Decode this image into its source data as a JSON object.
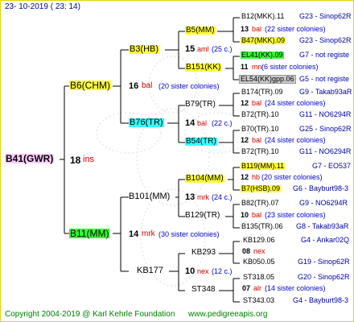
{
  "header": {
    "date": "23- 10-2019 ( 23: 14)"
  },
  "footer": {
    "copyright": "Copyright 2004-2019 @ Karl Kehrle Foundation",
    "url": "www.pedigreeapis.org"
  },
  "root": {
    "name": "B41(GWR)",
    "num": "18",
    "ins": "ins"
  },
  "colors": {
    "line": "#000000",
    "pink": "#ffccff",
    "yellow": "#ffff33",
    "green": "#33ff33",
    "cyan": "#33ffff"
  },
  "gen1": [
    {
      "name": "B6(CHM)",
      "num": "16",
      "word": "bal",
      "sis": "(20 sister colonies)"
    },
    {
      "name": "B11(MM)",
      "num": "14",
      "word": "mrk",
      "sis": "(30 sister colonies)"
    }
  ],
  "gen2": [
    {
      "name": "B3(HB)",
      "num": "15",
      "word": "aml",
      "sis": "(25 c.)"
    },
    {
      "name": "B76(TR)",
      "num": "14",
      "word": "bal",
      "sis": "(22 c.)"
    },
    {
      "name": "B101(MM)",
      "num": "13",
      "word": "mrk",
      "sis": "(24 c.)"
    },
    {
      "name": "KB177",
      "num": "10",
      "word": "nex",
      "sis": "(12 c.)"
    }
  ],
  "gen3": [
    {
      "name": "B5(MM)"
    },
    {
      "name": "B151(KK)"
    },
    {
      "name": "B79(TR)"
    },
    {
      "name": "B54(TR)"
    },
    {
      "name": "B104(MM)"
    },
    {
      "name": "B129(TR)"
    },
    {
      "name": "KB293"
    },
    {
      "name": "ST348"
    }
  ],
  "gen4": [
    {
      "top": "B12(MKK).11",
      "toplbl": "G23 - Sinop62R",
      "num": "13",
      "word": "bal",
      "sis": "(22 sister colonies)",
      "bot": "B47(MKK).09",
      "botlbl": "G23 - Sinop62R"
    },
    {
      "top": "EL41(KK).09",
      "toplbl": "G7 - not registe",
      "num": "11",
      "word": "mn",
      "sis": "(6 sister colonies)",
      "bot": "EL54(KK)gpp.06",
      "botlbl": "G5 - not registe"
    },
    {
      "top": "B174(TR).09",
      "toplbl": "G9 - Takab93aR",
      "num": "12",
      "word": "bal",
      "sis": "(24 sister colonies)",
      "bot": "B72(TR).10",
      "botlbl": "G11 - NO6294R"
    },
    {
      "top": "B70(TR).10",
      "toplbl": "G25 - Sinop62R",
      "num": "12",
      "word": "bal",
      "sis": "(24 sister colonies)",
      "bot": "B72(TR).10",
      "botlbl": "G11 - NO6294R"
    },
    {
      "top": "B119(MM).11",
      "toplbl": "G7 - EO537",
      "num": "12",
      "word": "hb",
      "sis": "(20 sister colonies)",
      "bot": "B7(HSB).09",
      "botlbl": "G6 - Bayburt98-3"
    },
    {
      "top": "B82(TR).07",
      "toplbl": "G9 - NO6294R",
      "num": "10",
      "word": "bal",
      "sis": "(23 sister colonies)",
      "bot": "B135(TR).06",
      "botlbl": "G8 - Takab93aR"
    },
    {
      "top": "KB129.06",
      "toplbl": "G4 - Ankar02Q",
      "num": "08",
      "word": "nex",
      "sis": "",
      "bot": "KB050.05",
      "botlbl": "G19 - Sinop62R"
    },
    {
      "top": "ST318.05",
      "toplbl": "G20 - Sinop62R",
      "num": "07",
      "word": "alr",
      "sis": "(14 sister colonies)",
      "bot": "ST343.03",
      "botlbl": "G4 - Bayburt98-3"
    }
  ]
}
